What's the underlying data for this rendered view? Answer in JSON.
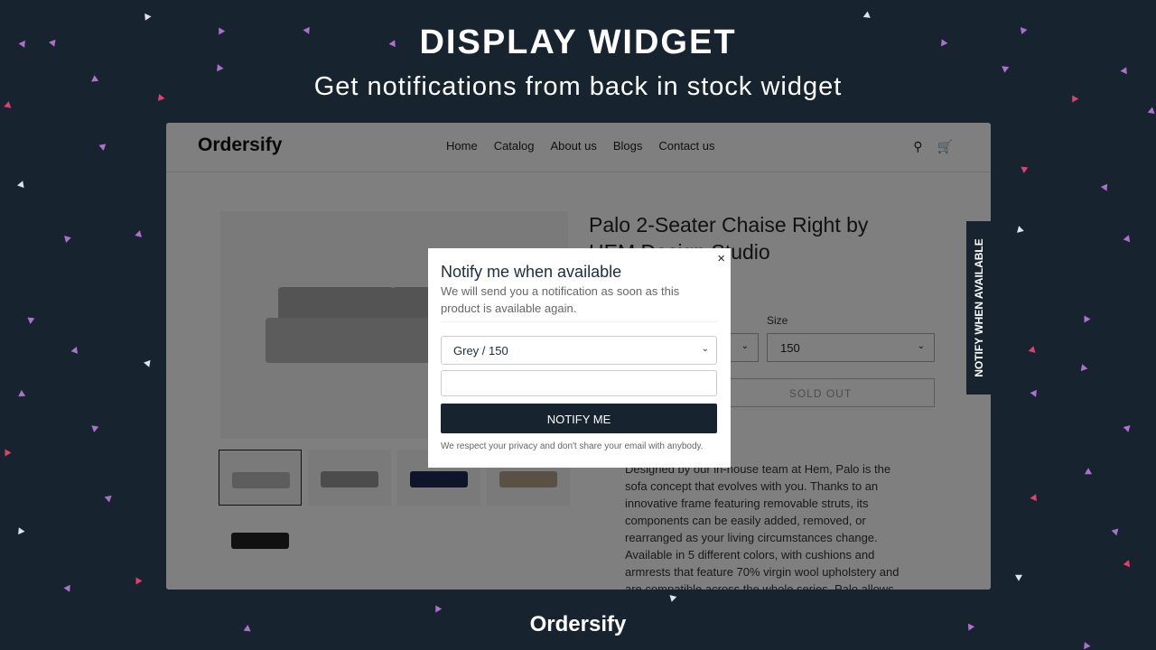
{
  "hero": {
    "title": "DISPLAY WIDGET",
    "subtitle": "Get notifications from back in stock widget"
  },
  "footer": {
    "brand": "Ordersify"
  },
  "store": {
    "logo": "Ordersify",
    "nav": [
      "Home",
      "Catalog",
      "About us",
      "Blogs",
      "Contact us"
    ],
    "icons": [
      "search-icon",
      "cart-icon"
    ],
    "product_title": "Palo 2-Seater Chaise Right by HEM Design Studio",
    "size_label": "Size",
    "size_value": "150",
    "sold_out_label": "SOLD OUT",
    "description": "Designed by our in-house team at Hem, Palo is the sofa concept that evolves with you. Thanks to an innovative frame featuring removable struts, its components can be easily added, removed, or rearranged as your living circumstances change. Available in 5 different colors, with cushions and armrests that feature 70% virgin wool upholstery and are compatible across the whole series. Palo allows"
  },
  "side_tab": {
    "label": "NOTIFY WHEN AVAILABLE"
  },
  "modal": {
    "close": "×",
    "title": "Notify me when available",
    "subtitle": "We will send you a notification as soon as this product is available again.",
    "variant_value": "Grey / 150",
    "email_value": "",
    "button": "NOTIFY ME",
    "privacy": "We respect your privacy and don't share your email with anybody."
  },
  "colors": {
    "background": "#17242f",
    "button": "#17242f",
    "confetti": [
      "#b06fd0",
      "#e0406a",
      "#dfe3ef"
    ]
  }
}
